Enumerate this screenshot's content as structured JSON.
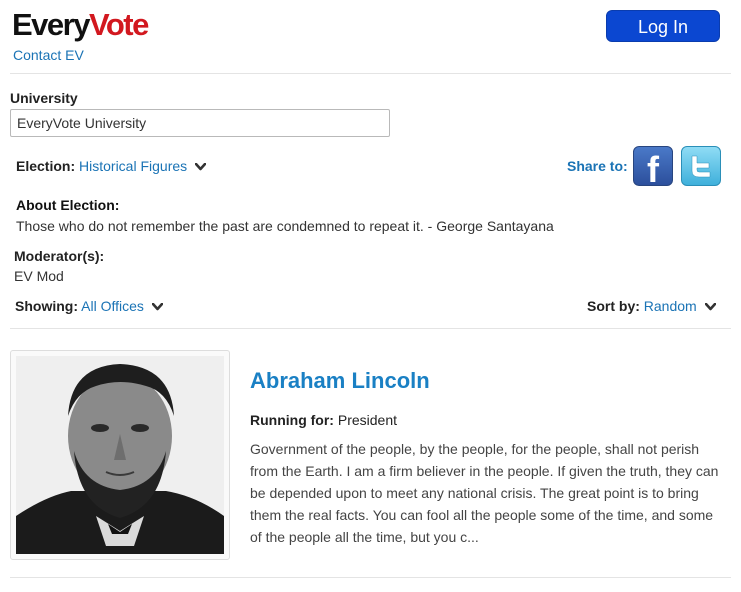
{
  "header": {
    "logo_part1": "Every",
    "logo_part2": "Vote",
    "contact_link": "Contact EV",
    "login_button": "Log In"
  },
  "university": {
    "label": "University",
    "value": "EveryVote University"
  },
  "election": {
    "label": "Election:",
    "value": "Historical Figures"
  },
  "share": {
    "label": "Share to:",
    "facebook_icon": "facebook-icon",
    "twitter_icon": "twitter-icon"
  },
  "about": {
    "label": "About Election:",
    "text": "Those who do not remember the past are condemned to repeat it. - George Santayana"
  },
  "moderators": {
    "label": "Moderator(s):",
    "value": "EV Mod"
  },
  "showing": {
    "label": "Showing:",
    "value": "All Offices"
  },
  "sort": {
    "label": "Sort by:",
    "value": "Random"
  },
  "candidate": {
    "name": "Abraham Lincoln",
    "running_label": "Running for:",
    "running_value": "President",
    "description": "Government of the people, by the people, for the people, shall not perish from the Earth. I am a firm believer in the people. If given the truth, they can be depended upon to meet any national crisis. The great point is to bring them the real facts. You can fool all the people some of the time, and some of the people all the time, but you c..."
  },
  "colors": {
    "link": "#1a73b5",
    "login_bg": "#0b47d1",
    "logo_red": "#d2181f",
    "candidate_name": "#1a80c4"
  }
}
